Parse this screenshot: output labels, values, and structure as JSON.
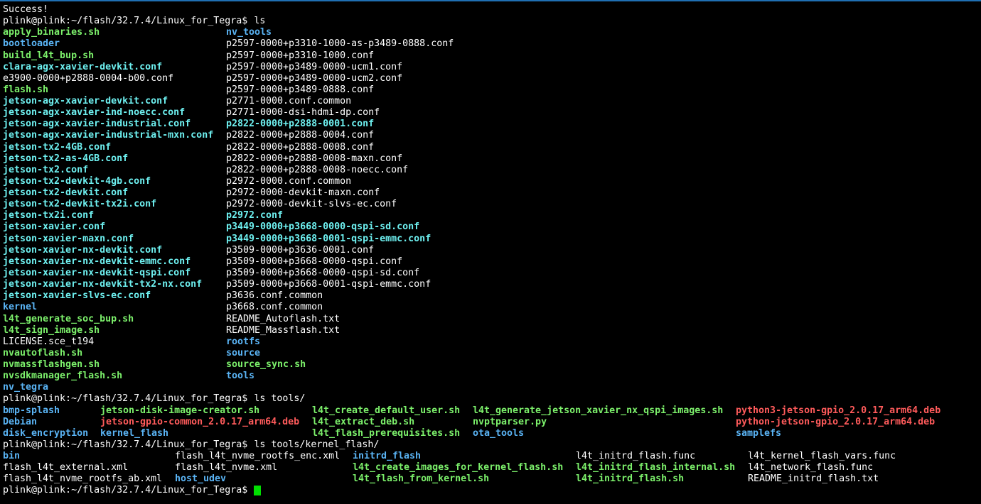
{
  "colors": {
    "background": "#000000",
    "text": "#ffffff",
    "directory": "#5ab4f5",
    "executable": "#7cf06b",
    "special": "#6ef0f0",
    "archive": "#ff5b5b",
    "cursor": "#00e000"
  },
  "terminal": {
    "success_line": "Success!",
    "prompts": [
      {
        "prompt": "plink@plink:~/flash/32.7.4/Linux_for_Tegra$",
        "command": "ls"
      },
      {
        "prompt": "plink@plink:~/flash/32.7.4/Linux_for_Tegra$",
        "command": "ls tools/"
      },
      {
        "prompt": "plink@plink:~/flash/32.7.4/Linux_for_Tegra$",
        "command": "ls tools/kernel_flash/"
      },
      {
        "prompt": "plink@plink:~/flash/32.7.4/Linux_for_Tegra$",
        "command": ""
      }
    ],
    "ls_root": {
      "col1": [
        {
          "name": "apply_binaries.sh",
          "kind": "executable"
        },
        {
          "name": "bootloader",
          "kind": "directory"
        },
        {
          "name": "build_l4t_bup.sh",
          "kind": "executable"
        },
        {
          "name": "clara-agx-xavier-devkit.conf",
          "kind": "special"
        },
        {
          "name": "e3900-0000+p2888-0004-b00.conf",
          "kind": "plain"
        },
        {
          "name": "flash.sh",
          "kind": "executable"
        },
        {
          "name": "jetson-agx-xavier-devkit.conf",
          "kind": "special"
        },
        {
          "name": "jetson-agx-xavier-ind-noecc.conf",
          "kind": "special"
        },
        {
          "name": "jetson-agx-xavier-industrial.conf",
          "kind": "special"
        },
        {
          "name": "jetson-agx-xavier-industrial-mxn.conf",
          "kind": "special"
        },
        {
          "name": "jetson-tx2-4GB.conf",
          "kind": "special"
        },
        {
          "name": "jetson-tx2-as-4GB.conf",
          "kind": "special"
        },
        {
          "name": "jetson-tx2.conf",
          "kind": "special"
        },
        {
          "name": "jetson-tx2-devkit-4gb.conf",
          "kind": "special"
        },
        {
          "name": "jetson-tx2-devkit.conf",
          "kind": "special"
        },
        {
          "name": "jetson-tx2-devkit-tx2i.conf",
          "kind": "special"
        },
        {
          "name": "jetson-tx2i.conf",
          "kind": "special"
        },
        {
          "name": "jetson-xavier.conf",
          "kind": "special"
        },
        {
          "name": "jetson-xavier-maxn.conf",
          "kind": "special"
        },
        {
          "name": "jetson-xavier-nx-devkit.conf",
          "kind": "special"
        },
        {
          "name": "jetson-xavier-nx-devkit-emmc.conf",
          "kind": "special"
        },
        {
          "name": "jetson-xavier-nx-devkit-qspi.conf",
          "kind": "special"
        },
        {
          "name": "jetson-xavier-nx-devkit-tx2-nx.conf",
          "kind": "special"
        },
        {
          "name": "jetson-xavier-slvs-ec.conf",
          "kind": "special"
        },
        {
          "name": "kernel",
          "kind": "directory"
        },
        {
          "name": "l4t_generate_soc_bup.sh",
          "kind": "executable"
        },
        {
          "name": "l4t_sign_image.sh",
          "kind": "executable"
        },
        {
          "name": "LICENSE.sce_t194",
          "kind": "plain"
        },
        {
          "name": "nvautoflash.sh",
          "kind": "executable"
        },
        {
          "name": "nvmassflashgen.sh",
          "kind": "executable"
        },
        {
          "name": "nvsdkmanager_flash.sh",
          "kind": "executable"
        },
        {
          "name": "nv_tegra",
          "kind": "directory"
        }
      ],
      "col2": [
        {
          "name": "nv_tools",
          "kind": "directory"
        },
        {
          "name": "p2597-0000+p3310-1000-as-p3489-0888.conf",
          "kind": "plain"
        },
        {
          "name": "p2597-0000+p3310-1000.conf",
          "kind": "plain"
        },
        {
          "name": "p2597-0000+p3489-0000-ucm1.conf",
          "kind": "plain"
        },
        {
          "name": "p2597-0000+p3489-0000-ucm2.conf",
          "kind": "plain"
        },
        {
          "name": "p2597-0000+p3489-0888.conf",
          "kind": "plain"
        },
        {
          "name": "p2771-0000.conf.common",
          "kind": "plain"
        },
        {
          "name": "p2771-0000-dsi-hdmi-dp.conf",
          "kind": "plain"
        },
        {
          "name": "p2822-0000+p2888-0001.conf",
          "kind": "special"
        },
        {
          "name": "p2822-0000+p2888-0004.conf",
          "kind": "plain"
        },
        {
          "name": "p2822-0000+p2888-0008.conf",
          "kind": "plain"
        },
        {
          "name": "p2822-0000+p2888-0008-maxn.conf",
          "kind": "plain"
        },
        {
          "name": "p2822-0000+p2888-0008-noecc.conf",
          "kind": "plain"
        },
        {
          "name": "p2972-0000.conf.common",
          "kind": "plain"
        },
        {
          "name": "p2972-0000-devkit-maxn.conf",
          "kind": "plain"
        },
        {
          "name": "p2972-0000-devkit-slvs-ec.conf",
          "kind": "plain"
        },
        {
          "name": "p2972.conf",
          "kind": "special"
        },
        {
          "name": "p3449-0000+p3668-0000-qspi-sd.conf",
          "kind": "special"
        },
        {
          "name": "p3449-0000+p3668-0001-qspi-emmc.conf",
          "kind": "special"
        },
        {
          "name": "p3509-0000+p3636-0001.conf",
          "kind": "plain"
        },
        {
          "name": "p3509-0000+p3668-0000-qspi.conf",
          "kind": "plain"
        },
        {
          "name": "p3509-0000+p3668-0000-qspi-sd.conf",
          "kind": "plain"
        },
        {
          "name": "p3509-0000+p3668-0001-qspi-emmc.conf",
          "kind": "plain"
        },
        {
          "name": "p3636.conf.common",
          "kind": "plain"
        },
        {
          "name": "p3668.conf.common",
          "kind": "plain"
        },
        {
          "name": "README_Autoflash.txt",
          "kind": "plain"
        },
        {
          "name": "README_Massflash.txt",
          "kind": "plain"
        },
        {
          "name": "rootfs",
          "kind": "directory"
        },
        {
          "name": "source",
          "kind": "directory"
        },
        {
          "name": "source_sync.sh",
          "kind": "executable"
        },
        {
          "name": "tools",
          "kind": "directory"
        }
      ]
    },
    "ls_tools": [
      [
        {
          "name": "bmp-splash",
          "kind": "directory"
        },
        {
          "name": "jetson-disk-image-creator.sh",
          "kind": "executable"
        },
        {
          "name": "l4t_create_default_user.sh",
          "kind": "executable"
        },
        {
          "name": "l4t_generate_jetson_xavier_nx_qspi_images.sh",
          "kind": "executable"
        },
        {
          "name": "python3-jetson-gpio_2.0.17_arm64.deb",
          "kind": "archive"
        }
      ],
      [
        {
          "name": "Debian",
          "kind": "directory"
        },
        {
          "name": "jetson-gpio-common_2.0.17_arm64.deb",
          "kind": "archive"
        },
        {
          "name": "l4t_extract_deb.sh",
          "kind": "executable"
        },
        {
          "name": "nvptparser.py",
          "kind": "executable"
        },
        {
          "name": "python-jetson-gpio_2.0.17_arm64.deb",
          "kind": "archive"
        }
      ],
      [
        {
          "name": "disk_encryption",
          "kind": "directory"
        },
        {
          "name": "kernel_flash",
          "kind": "directory"
        },
        {
          "name": "l4t_flash_prerequisites.sh",
          "kind": "executable"
        },
        {
          "name": "ota_tools",
          "kind": "directory"
        },
        {
          "name": "samplefs",
          "kind": "directory"
        }
      ]
    ],
    "ls_kernel_flash": [
      [
        {
          "name": "bin",
          "kind": "directory"
        },
        {
          "name": "flash_l4t_nvme_rootfs_enc.xml",
          "kind": "plain"
        },
        {
          "name": "initrd_flash",
          "kind": "directory"
        },
        {
          "name": "l4t_initrd_flash.func",
          "kind": "plain"
        },
        {
          "name": "l4t_kernel_flash_vars.func",
          "kind": "plain"
        }
      ],
      [
        {
          "name": "flash_l4t_external.xml",
          "kind": "plain"
        },
        {
          "name": "flash_l4t_nvme.xml",
          "kind": "plain"
        },
        {
          "name": "l4t_create_images_for_kernel_flash.sh",
          "kind": "executable"
        },
        {
          "name": "l4t_initrd_flash_internal.sh",
          "kind": "executable"
        },
        {
          "name": "l4t_network_flash.func",
          "kind": "plain"
        }
      ],
      [
        {
          "name": "flash_l4t_nvme_rootfs_ab.xml",
          "kind": "plain"
        },
        {
          "name": "host_udev",
          "kind": "directory"
        },
        {
          "name": "l4t_flash_from_kernel.sh",
          "kind": "executable"
        },
        {
          "name": "l4t_initrd_flash.sh",
          "kind": "executable"
        },
        {
          "name": "README_initrd_flash.txt",
          "kind": "plain"
        }
      ]
    ]
  }
}
